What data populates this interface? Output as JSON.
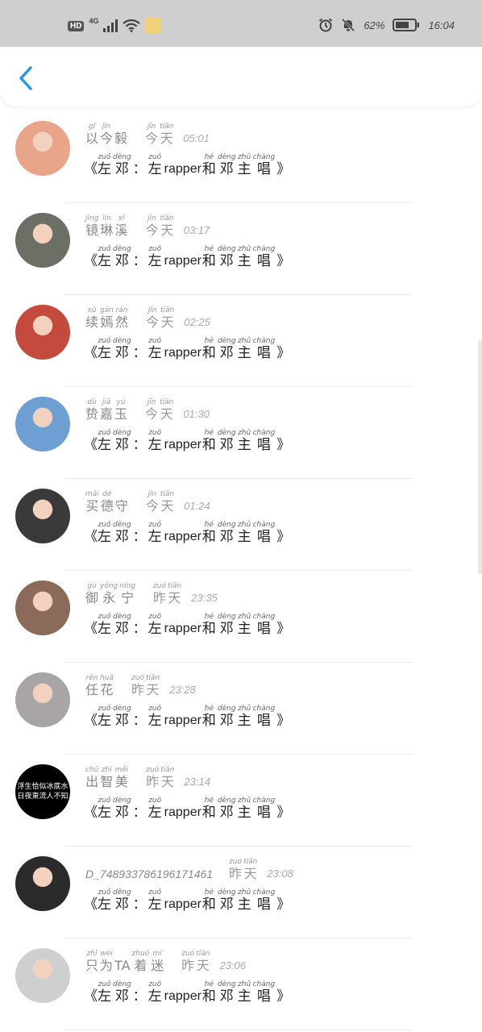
{
  "status_bar": {
    "hd": "HD",
    "network": "4G",
    "battery": "62%",
    "time": "16:04"
  },
  "nav": {
    "back_icon": "chevron-left-icon"
  },
  "message": {
    "open": "《",
    "close": "》",
    "latin": "rapper",
    "parts": [
      {
        "py": "zuǒ",
        "hz": "左"
      },
      {
        "py": "dèng",
        "hz": "邓"
      },
      {
        "py": "",
        "hz": "："
      },
      {
        "py": "zuǒ",
        "hz": "左"
      },
      {
        "py": "hé",
        "hz": "和"
      },
      {
        "py": "dèng",
        "hz": "邓"
      },
      {
        "py": "zhǔ",
        "hz": "主"
      },
      {
        "py": "chàng",
        "hz": "唱"
      }
    ]
  },
  "chats": [
    {
      "name": [
        {
          "py": "gǐ",
          "hz": "以"
        },
        {
          "py": "jīn",
          "hz": "今"
        },
        {
          "py": "",
          "hz": "毅"
        }
      ],
      "day": [
        {
          "py": "jīn",
          "hz": "今"
        },
        {
          "py": "tiān",
          "hz": "天"
        }
      ],
      "time": "05:01",
      "avatar_color": "#e9a58a"
    },
    {
      "name": [
        {
          "py": "jìng",
          "hz": "镜"
        },
        {
          "py": "lín",
          "hz": "琳"
        },
        {
          "py": "xī",
          "hz": "溪"
        }
      ],
      "day": [
        {
          "py": "jīn",
          "hz": "今"
        },
        {
          "py": "tiān",
          "hz": "天"
        }
      ],
      "time": "03:17",
      "avatar_color": "#6b6f66"
    },
    {
      "name": [
        {
          "py": "xù",
          "hz": "续"
        },
        {
          "py": "gān",
          "hz": "嫣"
        },
        {
          "py": "rán",
          "hz": "然"
        }
      ],
      "day": [
        {
          "py": "jīn",
          "hz": "今"
        },
        {
          "py": "tiān",
          "hz": "天"
        }
      ],
      "time": "02:25",
      "avatar_color": "#c44a3d"
    },
    {
      "name": [
        {
          "py": "dù",
          "hz": "贽"
        },
        {
          "py": "jiā",
          "hz": "嘉"
        },
        {
          "py": "yù",
          "hz": "玉"
        }
      ],
      "day": [
        {
          "py": "jīn",
          "hz": "今"
        },
        {
          "py": "tiān",
          "hz": "天"
        }
      ],
      "time": "01:30",
      "avatar_color": "#6d9fd3"
    },
    {
      "name": [
        {
          "py": "mǎi",
          "hz": "买"
        },
        {
          "py": "dé",
          "hz": "德"
        },
        {
          "py": "",
          "hz": "守"
        }
      ],
      "day": [
        {
          "py": "jīn",
          "hz": "今"
        },
        {
          "py": "tiān",
          "hz": "天"
        }
      ],
      "time": "01:24",
      "avatar_color": "#3a3a3a"
    },
    {
      "name": [
        {
          "py": "gù",
          "hz": "御"
        },
        {
          "py": "yǒng",
          "hz": "永"
        },
        {
          "py": "níng",
          "hz": "宁"
        }
      ],
      "day": [
        {
          "py": "zuó",
          "hz": "昨"
        },
        {
          "py": "tiān",
          "hz": "天"
        }
      ],
      "time": "23:35",
      "avatar_color": "#8a6a58"
    },
    {
      "name": [
        {
          "py": "rèn",
          "hz": "任"
        },
        {
          "py": "huā",
          "hz": "花"
        }
      ],
      "day": [
        {
          "py": "zuó",
          "hz": "昨"
        },
        {
          "py": "tiān",
          "hz": "天"
        }
      ],
      "time": "23:28",
      "avatar_color": "#a9a4a6"
    },
    {
      "name": [
        {
          "py": "chū",
          "hz": "出"
        },
        {
          "py": "zhì",
          "hz": "智"
        },
        {
          "py": "měi",
          "hz": "美"
        }
      ],
      "day": [
        {
          "py": "zuó",
          "hz": "昨"
        },
        {
          "py": "tiān",
          "hz": "天"
        }
      ],
      "time": "23:14",
      "avatar_color": "#000000",
      "avatar_text1": "浮生恰似冰底水",
      "avatar_text2": "日夜東流人不知"
    },
    {
      "name_plain": "D_748933786196171461",
      "day": [
        {
          "py": "zuó",
          "hz": "昨"
        },
        {
          "py": "tiān",
          "hz": "天"
        }
      ],
      "time": "23:08",
      "avatar_color": "#2b2b2b"
    },
    {
      "name": [
        {
          "py": "zhǐ",
          "hz": "只"
        },
        {
          "py": "wèi",
          "hz": "为"
        },
        {
          "py": "",
          "hz": "TA"
        },
        {
          "py": "zhuó",
          "hz": "着"
        },
        {
          "py": "mí",
          "hz": "迷"
        }
      ],
      "day": [
        {
          "py": "zuó",
          "hz": "昨"
        },
        {
          "py": "tiān",
          "hz": "天"
        }
      ],
      "time": "23:06",
      "avatar_color": "#cfcfcf"
    }
  ]
}
